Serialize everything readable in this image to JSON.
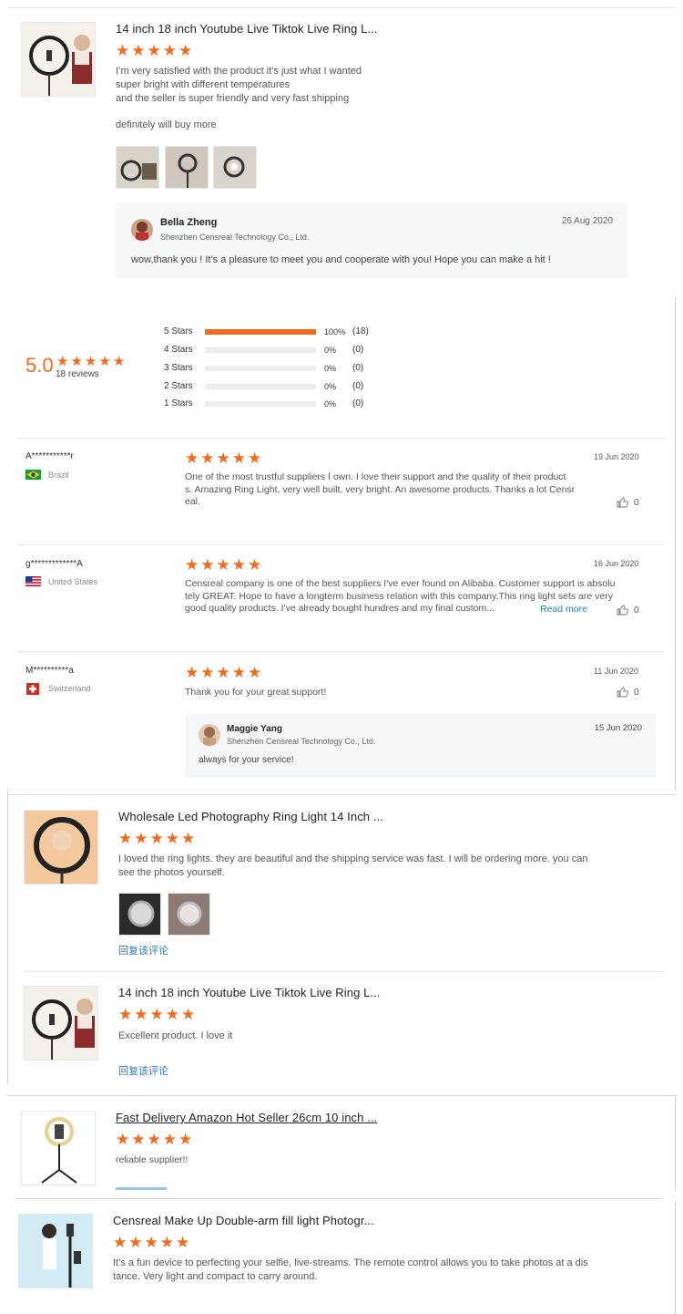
{
  "top_review": {
    "product_title": "14 inch 18 inch Youtube Live Tiktok Live Ring L...",
    "rating": 5,
    "text_lines": [
      "I’m very satisfied with the product it’s just what I wanted",
      "super bright with different temperatures",
      "and the seller is super friendly and very fast shipping",
      "",
      "definitely will buy more"
    ],
    "reply": {
      "name": "Bella Zheng",
      "company": "Shenzhen Censreal Technology Co., Ltd.",
      "date": "26 Aug 2020",
      "text": "wow,thank you !  It’s a pleasure to meet you and cooperate with you! Hope you can make a hit !"
    }
  },
  "summary": {
    "score": "5.0",
    "reviews_label": "18 reviews",
    "rows": [
      {
        "label": "5  Stars",
        "percent": "100%",
        "count": "(18)",
        "fill": 1.0
      },
      {
        "label": "4  Stars",
        "percent": "0%",
        "count": "(0)",
        "fill": 0
      },
      {
        "label": "3  Stars",
        "percent": "0%",
        "count": "(0)",
        "fill": 0
      },
      {
        "label": "2  Stars",
        "percent": "0%",
        "count": "(0)",
        "fill": 0
      },
      {
        "label": "1  Stars",
        "percent": "0%",
        "count": "(0)",
        "fill": 0
      }
    ]
  },
  "buyer_reviews": [
    {
      "name": "A***********r",
      "country": "Brazil",
      "date": "19 Jun 2020",
      "lines": [
        "One of the most trustful suppliers I own. I love their support and the quality of their product",
        "s. Amazing Ring Light, very well built, very bright. An awesome products. Thanks a lot Censr",
        "eal."
      ],
      "likes": "0"
    },
    {
      "name": "g*************A",
      "country": "United States",
      "date": "16 Jun 2020",
      "lines": [
        "Censreal company is one of the best suppliers I've ever found on Alibaba. Customer support is absolu",
        "tely GREAT. Hope to have a longterm business relation with this company.This ring light sets are very",
        "good quality products. I've already bought hundres and my final custom..."
      ],
      "read_more": "Read more",
      "likes": "0"
    },
    {
      "name": "M**********a",
      "country": "Switzerland",
      "date": "11 Jun 2020",
      "lines": [
        "Thank you for your great support!"
      ],
      "likes": "0",
      "reply": {
        "name": "Maggie Yang",
        "company": "Shenzhen Censreal Technology Co., Ltd.",
        "date": "15 Jun 2020",
        "text": "always for your service!"
      }
    }
  ],
  "product_reviews": [
    {
      "title": "Wholesale Led Photography Ring Light 14 Inch ...",
      "lines": [
        "I loved the ring lights. they are beautiful and the shipping service was fast. I will be ordering more. you can",
        "see the photos yourself."
      ],
      "reply_link": "回复该评论"
    },
    {
      "title": "14 inch 18 inch Youtube Live Tiktok Live Ring L...",
      "lines": [
        "Excellent product. I love it"
      ],
      "reply_link": "回复该评论"
    },
    {
      "title": "Fast Delivery Amazon Hot Seller 26cm 10 inch ...",
      "lines": [
        "reliable supplier!!"
      ]
    },
    {
      "title": "Censreal Make Up Double-arm fill light Photogr...",
      "lines": [
        "It’s a fun device to perfecting your selfie, live-streams. The remote control allows you to take photos at a dis",
        "tance. Very light and compact to carry around."
      ]
    }
  ],
  "colors": {
    "accent": "#f26b1d",
    "link": "#2a7ac0",
    "reply_bg": "#f5f6f8"
  },
  "icons": {
    "star": "star-icon",
    "like": "thumbs-up-icon"
  }
}
